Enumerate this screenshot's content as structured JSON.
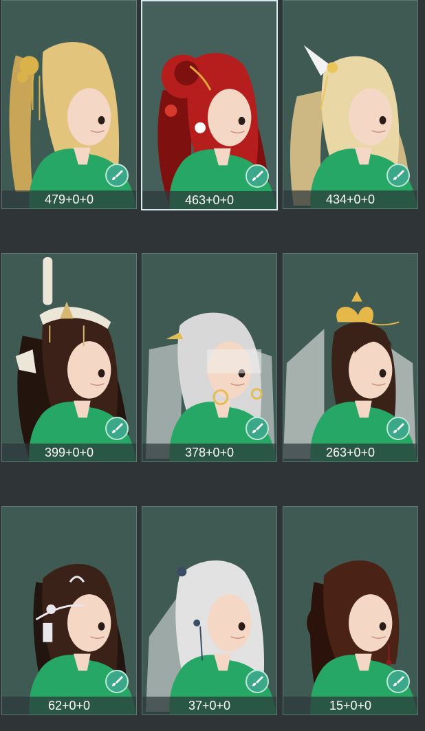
{
  "hairstyles": [
    {
      "label": "479+0+0",
      "hair": "#e2c47c",
      "hair_dark": "#c9a558",
      "accent": "#d9b24a",
      "style": "ponytail-gold",
      "selected": false
    },
    {
      "label": "463+0+0",
      "hair": "#b61d1d",
      "hair_dark": "#7e1010",
      "accent": "#e0a53b",
      "style": "buns-red",
      "selected": true
    },
    {
      "label": "434+0+0",
      "hair": "#e9d7a6",
      "hair_dark": "#cdb782",
      "accent": "#e8c65a",
      "style": "long-blonde",
      "selected": false
    },
    {
      "label": "399+0+0",
      "hair": "#3b2117",
      "hair_dark": "#24140e",
      "accent": "#d7b873",
      "style": "crown-dark",
      "selected": false
    },
    {
      "label": "378+0+0",
      "hair": "#d8d8d8",
      "hair_dark": "#b5b5b5",
      "accent": "#e0bd55",
      "style": "veil-silver",
      "selected": false
    },
    {
      "label": "263+0+0",
      "hair": "#3a2218",
      "hair_dark": "#22130c",
      "accent": "#e6b84a",
      "style": "veil-dark",
      "selected": false
    },
    {
      "label": "62+0+0",
      "hair": "#3a2219",
      "hair_dark": "#22140e",
      "accent": "#e8e8ec",
      "style": "circlet-dark",
      "selected": false
    },
    {
      "label": "37+0+0",
      "hair": "#e2e2e2",
      "hair_dark": "#bdbdbd",
      "accent": "#3a4c66",
      "style": "long-silver",
      "selected": false
    },
    {
      "label": "15+0+0",
      "hair": "#4a2216",
      "hair_dark": "#2b120b",
      "accent": "#8a1c1c",
      "style": "bob-auburn",
      "selected": false
    }
  ],
  "icons": {
    "edit": "brush-edit-icon"
  },
  "colors": {
    "skin": "#f4d7c4",
    "dress": "#27a766",
    "card_bg": "#3f5a53",
    "page_bg": "#2f3436"
  }
}
